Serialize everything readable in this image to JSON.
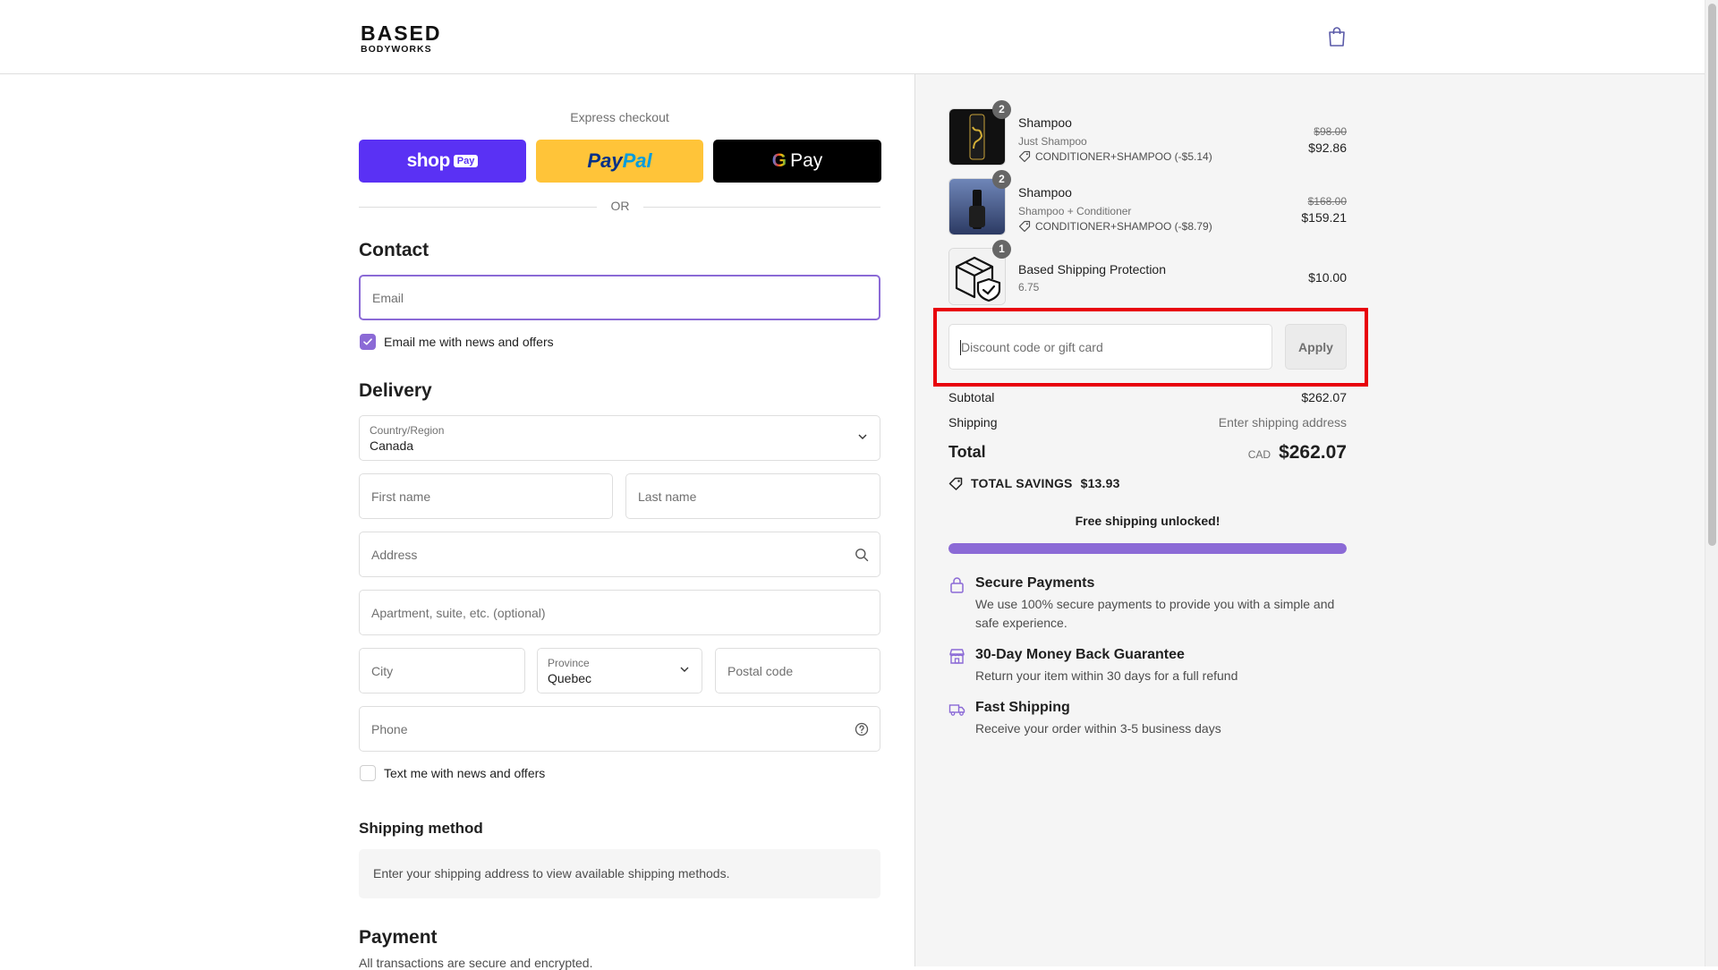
{
  "brand": {
    "line1": "BASED",
    "line2": "BODYWORKS"
  },
  "express": {
    "title": "Express checkout",
    "shop_word": "shop",
    "shop_pay": "Pay",
    "paypal_1": "Pay",
    "paypal_2": "Pal",
    "gpay_g": "G",
    "gpay_word": "Pay",
    "or": "OR"
  },
  "contact": {
    "title": "Contact",
    "email_placeholder": "Email",
    "news_label": "Email me with news and offers",
    "news_checked": true
  },
  "delivery": {
    "title": "Delivery",
    "country_label": "Country/Region",
    "country_value": "Canada",
    "first_name": "First name",
    "last_name": "Last name",
    "address": "Address",
    "apartment": "Apartment, suite, etc. (optional)",
    "city": "City",
    "province_label": "Province",
    "province_value": "Quebec",
    "postal": "Postal code",
    "phone": "Phone",
    "sms_label": "Text me with news and offers",
    "sms_checked": false
  },
  "shipping_method": {
    "title": "Shipping method",
    "note": "Enter your shipping address to view available shipping methods."
  },
  "payment": {
    "title": "Payment",
    "subtitle": "All transactions are secure and encrypted."
  },
  "cart": {
    "items": [
      {
        "qty": "2",
        "name": "Shampoo",
        "variant": "Just Shampoo",
        "discount": "CONDITIONER+SHAMPOO (-$5.14)",
        "old_price": "$98.00",
        "price": "$92.86"
      },
      {
        "qty": "2",
        "name": "Shampoo",
        "variant": "Shampoo + Conditioner",
        "discount": "CONDITIONER+SHAMPOO (-$8.79)",
        "old_price": "$168.00",
        "price": "$159.21"
      },
      {
        "qty": "1",
        "name": "Based Shipping Protection",
        "variant": "6.75",
        "price": "$10.00"
      }
    ],
    "discount_placeholder": "Discount code or gift card",
    "apply_label": "Apply",
    "subtotal_label": "Subtotal",
    "subtotal_value": "$262.07",
    "shipping_label": "Shipping",
    "shipping_value": "Enter shipping address",
    "total_label": "Total",
    "currency": "CAD",
    "total_value": "$262.07",
    "savings_label": "TOTAL SAVINGS",
    "savings_value": "$13.93",
    "free_shipping": "Free shipping unlocked!",
    "free_shipping_progress": 1.0
  },
  "features": [
    {
      "icon": "lock-icon",
      "title": "Secure Payments",
      "desc": "We use 100% secure payments to provide you with a simple and safe experience."
    },
    {
      "icon": "store-icon",
      "title": "30-Day Money Back Guarantee",
      "desc": "Return your item within 30 days for a full refund"
    },
    {
      "icon": "truck-icon",
      "title": "Fast Shipping",
      "desc": "Receive your order within 3-5 business days"
    }
  ],
  "colors": {
    "accent": "#8b6ad6",
    "shop_pay": "#5a31f4",
    "paypal": "#ffc439",
    "highlight": "#e8000b"
  }
}
